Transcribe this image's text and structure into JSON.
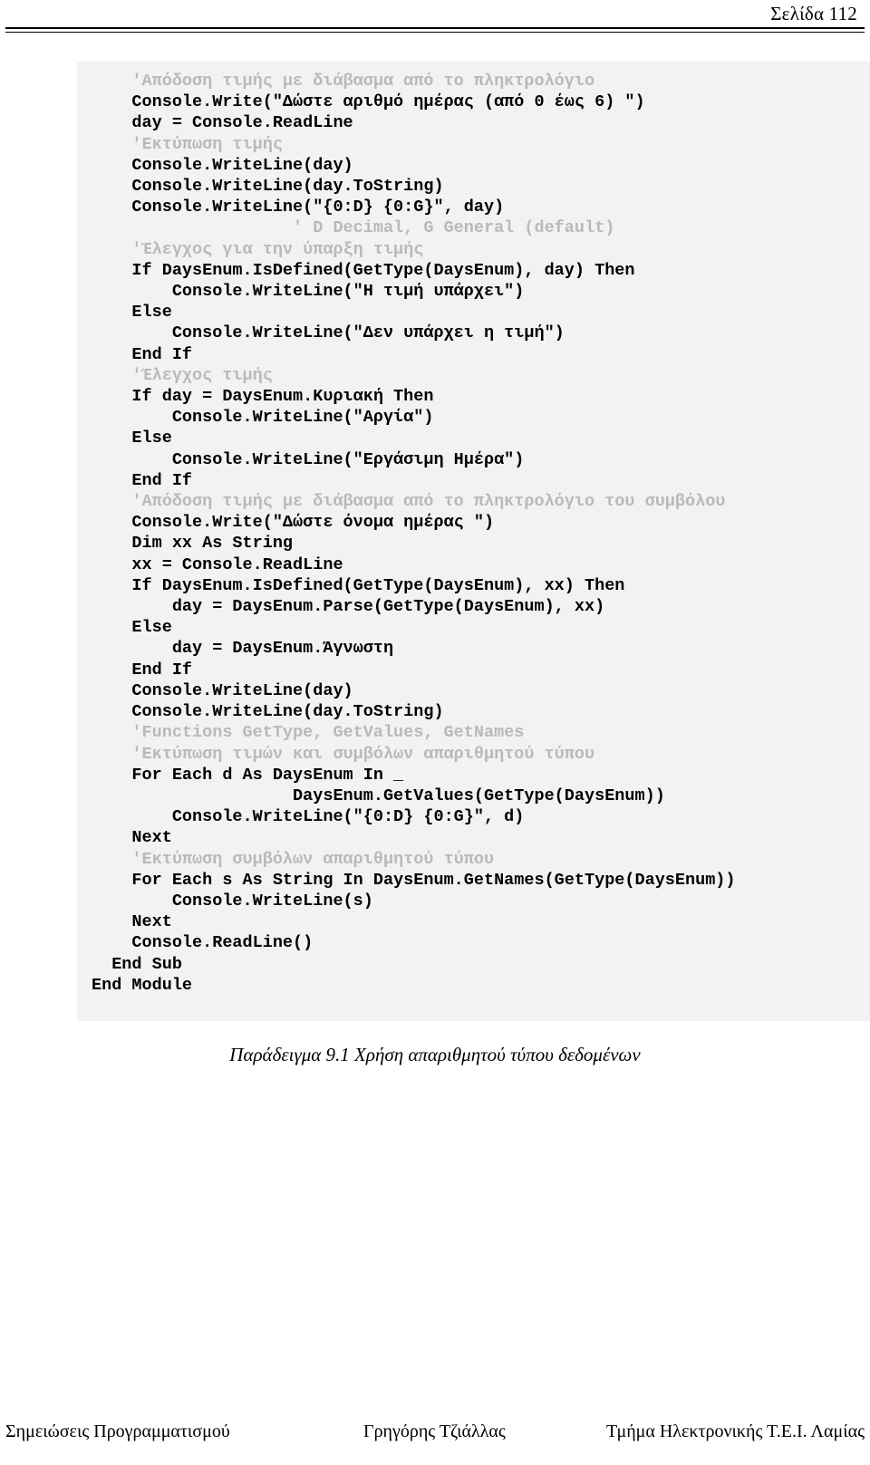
{
  "header": {
    "page_label": "Σελίδα 112"
  },
  "code_block": {
    "language": "VB.NET",
    "background_color": "#f2f2f2",
    "comment_color": "#b9b9b9",
    "text_color": "#000000",
    "lines": [
      {
        "text": "    'Απόδοση τιμής με διάβασμα από το πληκτρολόγιο",
        "kind": "comment"
      },
      {
        "text": "    Console.Write(\"Δώστε αριθμό ημέρας (από 0 έως 6) \")",
        "kind": "code"
      },
      {
        "text": "    day = Console.ReadLine",
        "kind": "code"
      },
      {
        "text": "    'Εκτύπωση τιμής",
        "kind": "comment"
      },
      {
        "text": "    Console.WriteLine(day)",
        "kind": "code"
      },
      {
        "text": "    Console.WriteLine(day.ToString)",
        "kind": "code"
      },
      {
        "text": "    Console.WriteLine(\"{0:D} {0:G}\", day)",
        "kind": "code"
      },
      {
        "text": "                    ' D Decimal, G General (default)",
        "kind": "comment"
      },
      {
        "text": "    'Έλεγχος για την ύπαρξη τιμής",
        "kind": "comment"
      },
      {
        "text": "    If DaysEnum.IsDefined(GetType(DaysEnum), day) Then",
        "kind": "code"
      },
      {
        "text": "        Console.WriteLine(\"Η τιμή υπάρχει\")",
        "kind": "code"
      },
      {
        "text": "    Else",
        "kind": "code"
      },
      {
        "text": "        Console.WriteLine(\"Δεν υπάρχει η τιμή\")",
        "kind": "code"
      },
      {
        "text": "    End If",
        "kind": "code"
      },
      {
        "text": "    'Έλεγχος τιμής",
        "kind": "comment"
      },
      {
        "text": "    If day = DaysEnum.Κυριακή Then",
        "kind": "code"
      },
      {
        "text": "        Console.WriteLine(\"Αργία\")",
        "kind": "code"
      },
      {
        "text": "    Else",
        "kind": "code"
      },
      {
        "text": "        Console.WriteLine(\"Εργάσιμη Ημέρα\")",
        "kind": "code"
      },
      {
        "text": "    End If",
        "kind": "code"
      },
      {
        "text": "    'Απόδοση τιμής με διάβασμα από το πληκτρολόγιο του συμβόλου",
        "kind": "comment"
      },
      {
        "text": "    Console.Write(\"Δώστε όνομα ημέρας \")",
        "kind": "code"
      },
      {
        "text": "    Dim xx As String",
        "kind": "code"
      },
      {
        "text": "    xx = Console.ReadLine",
        "kind": "code"
      },
      {
        "text": "    If DaysEnum.IsDefined(GetType(DaysEnum), xx) Then",
        "kind": "code"
      },
      {
        "text": "        day = DaysEnum.Parse(GetType(DaysEnum), xx)",
        "kind": "code"
      },
      {
        "text": "    Else",
        "kind": "code"
      },
      {
        "text": "        day = DaysEnum.Άγνωστη",
        "kind": "code"
      },
      {
        "text": "    End If",
        "kind": "code"
      },
      {
        "text": "    Console.WriteLine(day)",
        "kind": "code"
      },
      {
        "text": "    Console.WriteLine(day.ToString)",
        "kind": "code"
      },
      {
        "text": "    'Functions GetType, GetValues, GetNames",
        "kind": "comment"
      },
      {
        "text": "    'Εκτύπωση τιμών και συμβόλων απαριθμητού τύπου",
        "kind": "comment"
      },
      {
        "text": "    For Each d As DaysEnum In _",
        "kind": "code"
      },
      {
        "text": "                    DaysEnum.GetValues(GetType(DaysEnum))",
        "kind": "code"
      },
      {
        "text": "        Console.WriteLine(\"{0:D} {0:G}\", d)",
        "kind": "code"
      },
      {
        "text": "    Next",
        "kind": "code"
      },
      {
        "text": "    'Εκτύπωση συμβόλων απαριθμητού τύπου",
        "kind": "comment"
      },
      {
        "text": "    For Each s As String In DaysEnum.GetNames(GetType(DaysEnum))",
        "kind": "code"
      },
      {
        "text": "        Console.WriteLine(s)",
        "kind": "code"
      },
      {
        "text": "    Next",
        "kind": "code"
      },
      {
        "text": "    Console.ReadLine()",
        "kind": "code"
      },
      {
        "text": "  End Sub",
        "kind": "code"
      },
      {
        "text": "",
        "kind": "blank"
      },
      {
        "text": "End Module",
        "kind": "code"
      }
    ]
  },
  "caption": {
    "text": "Παράδειγμα 9.1 Χρήση απαριθμητού τύπου δεδομένων"
  },
  "footer": {
    "left": "Σημειώσεις Προγραμματισμού",
    "center": "Γρηγόρης Τζιάλλας",
    "right": "Τμήμα Ηλεκτρονικής Τ.Ε.Ι. Λαμίας"
  }
}
